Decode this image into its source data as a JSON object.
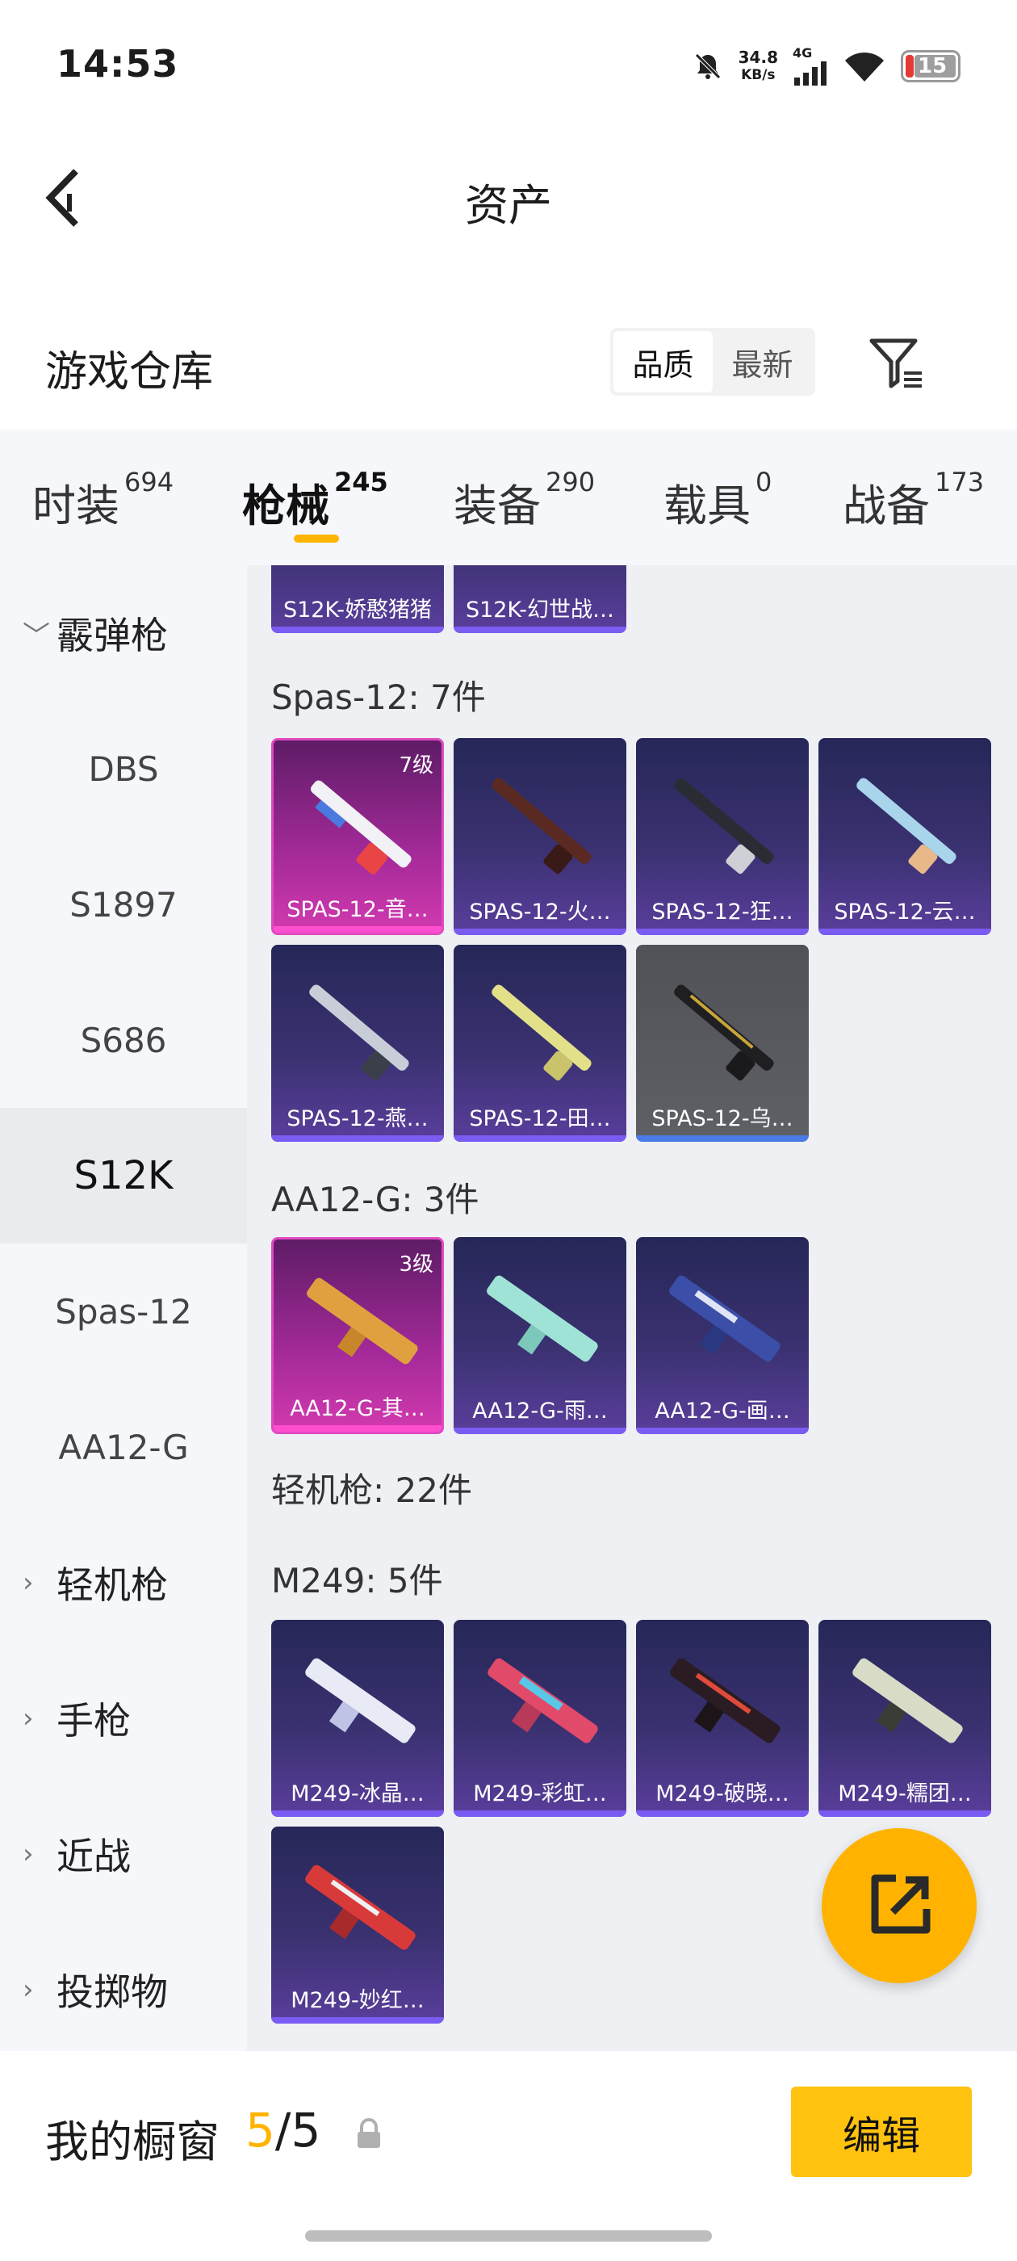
{
  "status_bar": {
    "time": "14:53",
    "net_speed_value": "34.8",
    "net_speed_unit": "KB/s",
    "network": "4G",
    "battery": "15"
  },
  "header": {
    "title": "资产",
    "back_icon": "back-arrow-icon"
  },
  "warehouse": {
    "title": "游戏仓库",
    "sort_options": [
      "品质",
      "最新"
    ],
    "sort_selected": "品质",
    "filter_icon": "filter-icon"
  },
  "tabs": [
    {
      "label": "时装",
      "count": "694"
    },
    {
      "label": "枪械",
      "count": "245",
      "active": true
    },
    {
      "label": "装备",
      "count": "290"
    },
    {
      "label": "载具",
      "count": "0"
    },
    {
      "label": "战备",
      "count": "173"
    }
  ],
  "sidebar": [
    {
      "label": "霰弹枪",
      "type": "group",
      "expanded": true
    },
    {
      "label": "DBS"
    },
    {
      "label": "S1897"
    },
    {
      "label": "S686"
    },
    {
      "label": "S12K",
      "active": true
    },
    {
      "label": "Spas-12"
    },
    {
      "label": "AA12-G"
    },
    {
      "label": "轻机枪",
      "type": "group"
    },
    {
      "label": "手枪",
      "type": "group"
    },
    {
      "label": "近战",
      "type": "group"
    },
    {
      "label": "投掷物",
      "type": "group"
    }
  ],
  "content": {
    "s12k_partial": [
      "S12K-娇憨猪猪",
      "S12K-幻世战…"
    ],
    "spas12": {
      "title": "Spas-12: 7件",
      "items": [
        {
          "name": "SPAS-12-音…",
          "level": "7级",
          "tier": "pink"
        },
        {
          "name": "SPAS-12-火…",
          "tier": "purple"
        },
        {
          "name": "SPAS-12-狂…",
          "tier": "purple"
        },
        {
          "name": "SPAS-12-云…",
          "tier": "purple"
        },
        {
          "name": "SPAS-12-燕…",
          "tier": "purple"
        },
        {
          "name": "SPAS-12-田…",
          "tier": "purple"
        },
        {
          "name": "SPAS-12-乌…",
          "tier": "gray"
        }
      ]
    },
    "aa12g": {
      "title": "AA12-G: 3件",
      "items": [
        {
          "name": "AA12-G-其…",
          "level": "3级",
          "tier": "pink"
        },
        {
          "name": "AA12-G-雨…",
          "tier": "purple"
        },
        {
          "name": "AA12-G-画…",
          "tier": "purple"
        }
      ]
    },
    "lmg_title": "轻机枪: 22件",
    "m249": {
      "title": "M249: 5件",
      "items": [
        {
          "name": "M249-冰晶…",
          "tier": "purple"
        },
        {
          "name": "M249-彩虹…",
          "tier": "purple"
        },
        {
          "name": "M249-破晓…",
          "tier": "purple"
        },
        {
          "name": "M249-糯团…",
          "tier": "purple"
        },
        {
          "name": "M249-妙红…",
          "tier": "purple"
        }
      ]
    }
  },
  "fab": {
    "icon": "share-export-icon"
  },
  "bottom": {
    "showcase_label": "我的橱窗",
    "showcase_current": "5",
    "showcase_total": "/5",
    "edit_label": "编辑"
  },
  "colors": {
    "accent": "#ffb300",
    "edit_button": "#ffc20e",
    "card_purple": "#3a3170",
    "card_pink": "#a52a9a"
  }
}
